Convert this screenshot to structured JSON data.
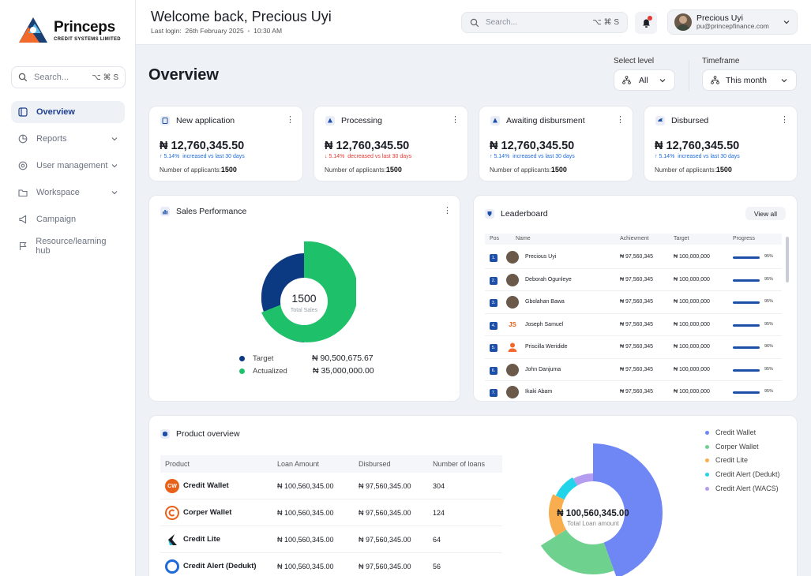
{
  "brand": {
    "name": "Princeps",
    "subtitle": "CREDIT SYSTEMS LIMITED"
  },
  "sidebar": {
    "search_placeholder": "Search...",
    "search_shortcut": "⌥ ⌘ S",
    "items": [
      {
        "label": "Overview",
        "icon": "overview-icon",
        "active": true
      },
      {
        "label": "Reports",
        "icon": "reports-icon",
        "has_children": true
      },
      {
        "label": "User management",
        "icon": "user-management-icon",
        "has_children": true
      },
      {
        "label": "Workspace",
        "icon": "workspace-icon",
        "has_children": true
      },
      {
        "label": "Campaign",
        "icon": "campaign-icon"
      },
      {
        "label": "Resource/learning hub",
        "icon": "flag-icon"
      }
    ]
  },
  "header": {
    "welcome": "Welcome back, Precious Uyi",
    "last_login_label": "Last login:",
    "last_login_date": "26th February 2025",
    "last_login_time": "10:30 AM",
    "search_placeholder": "Search...",
    "search_shortcut": "⌥ ⌘ S",
    "user_name": "Precious Uyi",
    "user_email": "pu@princepfinance.com"
  },
  "page": {
    "title": "Overview",
    "select_level_label": "Select level",
    "select_level_value": "All",
    "timeframe_label": "Timeframe",
    "timeframe_value": "This month"
  },
  "stats": [
    {
      "title": "New application",
      "amount": "₦ 12,760,345.50",
      "change": "5.14%",
      "change_text": "increased vs last 30 days",
      "direction": "up",
      "count_label": "Number of applicants:",
      "count": "1500"
    },
    {
      "title": "Processing",
      "amount": "₦ 12,760,345.50",
      "change": "5.14%",
      "change_text": "decreased vs last 30 days",
      "direction": "down",
      "count_label": "Number of applicants:",
      "count": "1500"
    },
    {
      "title": "Awaiting disbursment",
      "amount": "₦ 12,760,345.50",
      "change": "5.14%",
      "change_text": "increased vs last 30 days",
      "direction": "up",
      "count_label": "Number of applicants:",
      "count": "1500"
    },
    {
      "title": "Disbursed",
      "amount": "₦ 12,760,345.50",
      "change": "5.14%",
      "change_text": "increased vs last 30 days",
      "direction": "up",
      "count_label": "Number of applicants:",
      "count": "1500"
    }
  ],
  "sales": {
    "title": "Sales Performance",
    "total": "1500",
    "total_label": "Total Sales",
    "legend": [
      {
        "label": "Target",
        "value": "₦ 90,500,675.67",
        "color": "#0b3a82"
      },
      {
        "label": "Actualized",
        "value": "₦ 35,000,000.00",
        "color": "#1fc06a"
      }
    ]
  },
  "leaderboard": {
    "title": "Leaderboard",
    "view_all": "View all",
    "columns": [
      "Pos",
      "Name",
      "Achievment",
      "Target",
      "Progress"
    ],
    "rows": [
      {
        "pos": "1.",
        "name": "Precious Uyi",
        "achievement": "₦ 97,560,345",
        "target": "₦ 100,000,000",
        "progress": 0.95,
        "pct": "95%",
        "avatar": "photo"
      },
      {
        "pos": "2.",
        "name": "Deborah Ogunleye",
        "achievement": "₦ 97,560,345",
        "target": "₦ 100,000,000",
        "progress": 0.95,
        "pct": "95%",
        "avatar": "photo"
      },
      {
        "pos": "3.",
        "name": "Gbolahan Bawa",
        "achievement": "₦ 97,560,345",
        "target": "₦ 100,000,000",
        "progress": 0.95,
        "pct": "95%",
        "avatar": "photo"
      },
      {
        "pos": "4.",
        "name": "Joseph Samuel",
        "achievement": "₦ 97,560,345",
        "target": "₦ 100,000,000",
        "progress": 0.95,
        "pct": "95%",
        "avatar": "JS"
      },
      {
        "pos": "5.",
        "name": "Priscilla Weridide",
        "achievement": "₦ 97,560,345",
        "target": "₦ 100,000,000",
        "progress": 0.96,
        "pct": "96%",
        "avatar": "user-icon"
      },
      {
        "pos": "6.",
        "name": "John Danjuma",
        "achievement": "₦ 97,560,345",
        "target": "₦ 100,000,000",
        "progress": 0.95,
        "pct": "95%",
        "avatar": "photo"
      },
      {
        "pos": "7.",
        "name": "Ikaki Abam",
        "achievement": "₦ 97,560,345",
        "target": "₦ 100,000,000",
        "progress": 0.95,
        "pct": "95%",
        "avatar": "photo"
      }
    ]
  },
  "products": {
    "title": "Product overview",
    "columns": [
      "Product",
      "Loan Amount",
      "Disbursed",
      "Number of loans"
    ],
    "rows": [
      {
        "name": "Credit Wallet",
        "loan": "₦ 100,560,345.00",
        "disbursed": "₦ 97,560,345.00",
        "count": "304",
        "logo": "CW",
        "color": "#e8611a"
      },
      {
        "name": "Corper Wallet",
        "loan": "₦ 100,560,345.00",
        "disbursed": "₦ 97,560,345.00",
        "count": "124",
        "logo": "corper-wallet-logo",
        "color": "#e8611a"
      },
      {
        "name": "Credit Lite",
        "loan": "₦ 100,560,345.00",
        "disbursed": "₦ 97,560,345.00",
        "count": "64",
        "logo": "credit-lite-logo",
        "color": "#1a1d24"
      },
      {
        "name": "Credit Alert (Dedukt)",
        "loan": "₦ 100,560,345.00",
        "disbursed": "₦ 97,560,345.00",
        "count": "56",
        "logo": "credit-alert-logo",
        "color": "#1e6ad8"
      }
    ],
    "total": "₦ 100,560,345.00",
    "total_label": "Total Loan amount",
    "legend": [
      {
        "label": "Credit Wallet",
        "color": "#6f86f5"
      },
      {
        "label": "Corper Wallet",
        "color": "#6fd18e"
      },
      {
        "label": "Credit Lite",
        "color": "#f8ad4e"
      },
      {
        "label": "Credit Alert (Dedukt)",
        "color": "#22d4ea"
      },
      {
        "label": "Credit Alert (WACS)",
        "color": "#b49cf0"
      }
    ]
  },
  "colors": {
    "accent": "#1e4fa8",
    "up": "#1e6ad8",
    "down": "#e53935"
  }
}
